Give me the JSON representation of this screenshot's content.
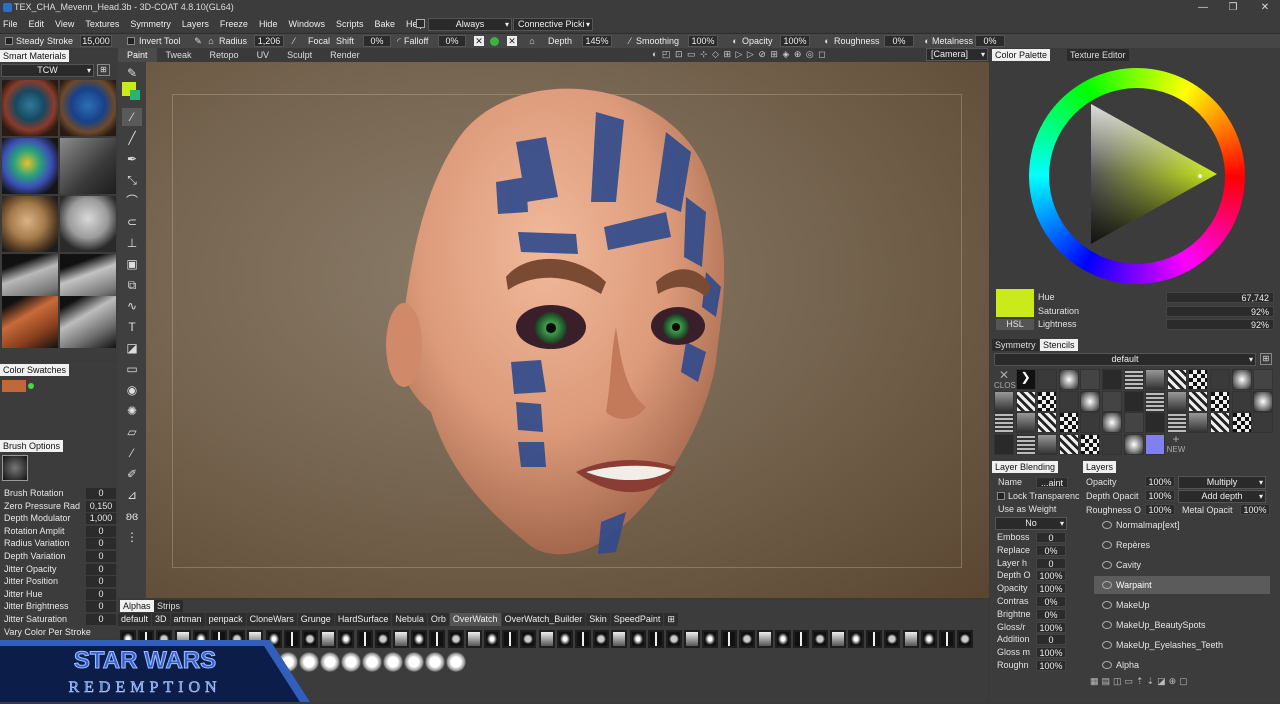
{
  "window": {
    "title": "TEX_CHA_Mevenn_Head.3b - 3D-COAT 4.8.10(GL64)",
    "min": "—",
    "max": "❐",
    "close": "✕"
  },
  "menu": [
    "File",
    "Edit",
    "View",
    "Textures",
    "Symmetry",
    "Layers",
    "Freeze",
    "Hide",
    "Windows",
    "Scripts",
    "Bake",
    "Help"
  ],
  "menu_extras": {
    "always": "Always",
    "connective": "Connective Picki"
  },
  "toolbar": {
    "steady": "Steady",
    "stroke": "Stroke",
    "stroke_val": "15,000",
    "invert": "Invert",
    "tool": "Tool",
    "radius": "Radius",
    "radius_val": "1,206",
    "focal": "Focal",
    "shift": "Shift",
    "focal_val": "0%",
    "falloff": "Falloff",
    "falloff_val": "0%",
    "depth": "Depth",
    "depth_val": "145%",
    "smoothing": "Smoothing",
    "smoothing_val": "100%",
    "opacity": "Opacity",
    "opacity_val": "100%",
    "roughness": "Roughness",
    "roughness_val": "0%",
    "metalness": "Metalness",
    "metalness_val": "0%"
  },
  "rooms": [
    "Paint",
    "Tweak",
    "Retopo",
    "UV",
    "Sculpt",
    "Render"
  ],
  "camera": "[Camera]",
  "viewtools": "◐ ◰ ⊡ ▭ ⊹ ◇ ⊞ ▷ ▷ ⊘ ⊞ ◈ ⊕ ◎ ◻",
  "smart_materials": {
    "tab": "Smart Materials",
    "folder": "TCW"
  },
  "color_swatches": {
    "tab": "Color Swatches",
    "swatch": "#c0683a"
  },
  "brush_options": {
    "tab": "Brush Options",
    "rows": [
      {
        "label": "Brush Rotation",
        "value": "0"
      },
      {
        "label": "Zero Pressure Rad",
        "value": "0,150"
      },
      {
        "label": "Depth Modulator",
        "value": "1,000"
      },
      {
        "label": "Rotation Amplit",
        "value": "0"
      },
      {
        "label": "Radius Variation",
        "value": "0"
      },
      {
        "label": "Depth Variation",
        "value": "0"
      },
      {
        "label": "Jitter Opacity",
        "value": "0"
      },
      {
        "label": "Jitter Position",
        "value": "0"
      },
      {
        "label": "Jitter Hue",
        "value": "0"
      },
      {
        "label": "Jitter Brightness",
        "value": "0"
      },
      {
        "label": "Jitter Saturation",
        "value": "0"
      },
      {
        "label": "Vary Color Per Stroke",
        "value": ""
      }
    ]
  },
  "alphas": {
    "tabs": [
      "Alphas",
      "Strips"
    ],
    "categories": [
      "default",
      "3D",
      "artman",
      "penpack",
      "CloneWars",
      "Grunge",
      "HardSurface",
      "Nebula",
      "Orb",
      "OverWatch",
      "OverWatch_Builder",
      "Skin",
      "SpeedPaint"
    ],
    "active": "OverWatch"
  },
  "right_tabs": {
    "color_palette": "Color Palette",
    "texture_editor": "Texture Editor"
  },
  "color": {
    "current": "#cbea1a",
    "hue_label": "Hue",
    "hue": "67,742",
    "sat_label": "Saturation",
    "sat": "92%",
    "light_label": "Lightness",
    "light": "92%",
    "mode": "HSL"
  },
  "stencils": {
    "symmetry": "Symmetry",
    "stencils": "Stencils",
    "preset": "default",
    "close": "CLOSE",
    "new": "NEW"
  },
  "layer_blending": {
    "tab": "Layer Blending",
    "name_label": "Name",
    "name_val": "...aint",
    "lock": "Lock Transparenc",
    "use_weight": "Use as Weight",
    "no": "No",
    "rows": [
      {
        "label": "Emboss",
        "value": "0"
      },
      {
        "label": "Replace",
        "value": "0%"
      },
      {
        "label": "Layer h",
        "value": "0"
      },
      {
        "label": "Depth O",
        "value": "100%"
      },
      {
        "label": "Opacity",
        "value": "100%"
      },
      {
        "label": "Contras",
        "value": "0%"
      },
      {
        "label": "Brightne",
        "value": "0%"
      },
      {
        "label": "Gloss/r",
        "value": "100%"
      },
      {
        "label": "Addition",
        "value": "0"
      },
      {
        "label": "Gloss m",
        "value": "100%"
      },
      {
        "label": "Roughn",
        "value": "100%"
      }
    ]
  },
  "layers": {
    "tab": "Layers",
    "opacity_label": "Opacity",
    "opacity": "100%",
    "blend": "Multiply",
    "depth_label": "Depth Opacit",
    "depth": "100%",
    "depth_mode": "Add depth",
    "rough_label": "Roughness O",
    "rough": "100%",
    "metal_label": "Metal Opacit",
    "metal": "100%",
    "items": [
      "Normalmap[ext]",
      "Repères",
      "Cavity",
      "Warpaint",
      "MakeUp",
      "MakeUp_BeautySpots",
      "MakeUp_Eyelashes_Teeth",
      "Alpha"
    ],
    "selected": "Warpaint"
  },
  "logo": {
    "line1": "STAR WARS",
    "line2": "REDEMPTION"
  }
}
